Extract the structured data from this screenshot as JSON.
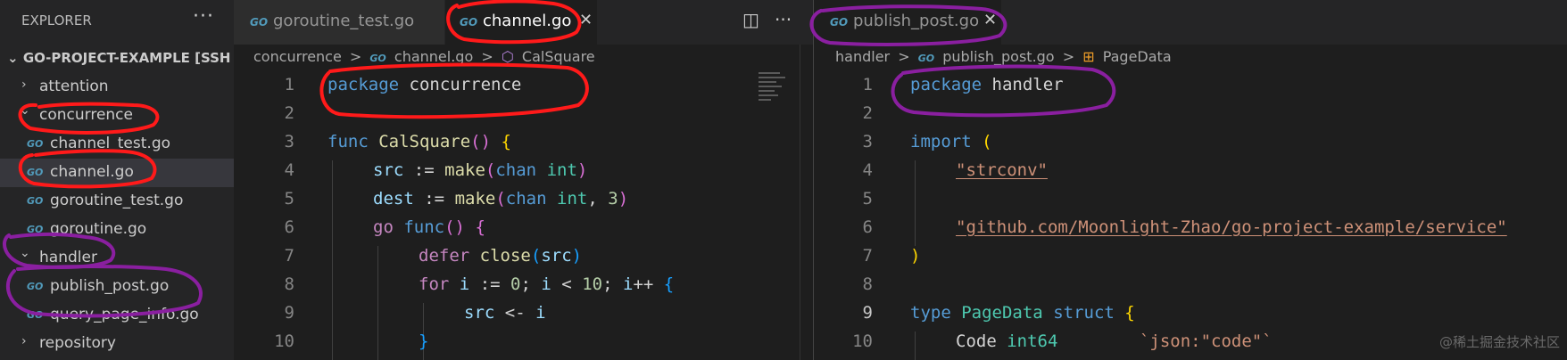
{
  "explorer": {
    "title": "EXPLORER",
    "more": "···",
    "project": "GO-PROJECT-EXAMPLE [SSH: ...",
    "items": [
      {
        "chev": "›",
        "label": "attention",
        "type": "folder"
      },
      {
        "chev": "⌄",
        "label": "concurrence",
        "type": "folder"
      },
      {
        "icon": "GO",
        "label": "channel_test.go",
        "type": "file"
      },
      {
        "icon": "GO",
        "label": "channel.go",
        "type": "file"
      },
      {
        "icon": "GO",
        "label": "goroutine_test.go",
        "type": "file"
      },
      {
        "icon": "GO",
        "label": "goroutine.go",
        "type": "file"
      },
      {
        "chev": "⌄",
        "label": "handler",
        "type": "folder"
      },
      {
        "icon": "GO",
        "label": "publish_post.go",
        "type": "file"
      },
      {
        "icon": "GO",
        "label": "query_page_info.go",
        "type": "file"
      },
      {
        "chev": "›",
        "label": "repository",
        "type": "folder"
      }
    ]
  },
  "left_editor": {
    "tabs": [
      {
        "icon": "GO",
        "label": "goroutine_test.go"
      },
      {
        "icon": "GO",
        "label": "channel.go",
        "close": "✕"
      }
    ],
    "split_icon": "◫",
    "more": "···",
    "breadcrumb": {
      "a": "concurrence",
      "sep": ">",
      "icon": "GO",
      "b": "channel.go",
      "sep2": ">",
      "c": "CalSquare"
    },
    "line_numbers": [
      "1",
      "2",
      "3",
      "4",
      "5",
      "6",
      "7",
      "8",
      "9",
      "10"
    ]
  },
  "right_editor": {
    "tabs": [
      {
        "icon": "GO",
        "label": "publish_post.go",
        "close": "✕"
      }
    ],
    "breadcrumb": {
      "a": "handler",
      "sep": ">",
      "icon": "GO",
      "b": "publish_post.go",
      "sep2": ">",
      "c": "PageData"
    },
    "line_numbers": [
      "1",
      "2",
      "3",
      "4",
      "5",
      "6",
      "7",
      "8",
      "9",
      "10"
    ]
  },
  "code_left": {
    "l1": [
      "package",
      "concurrence"
    ],
    "l3": [
      "func",
      "CalSquare",
      "()",
      "{"
    ],
    "l4": [
      "src",
      ":=",
      "make",
      "(",
      "chan",
      "int",
      ")"
    ],
    "l5": [
      "dest",
      ":=",
      "make",
      "(",
      "chan",
      "int",
      ",",
      "3",
      ")"
    ],
    "l6": [
      "go",
      "func",
      "()",
      "{"
    ],
    "l7": [
      "defer",
      "close",
      "(",
      "src",
      ")"
    ],
    "l8": [
      "for",
      "i",
      ":=",
      "0",
      ";",
      "i",
      "<",
      "10",
      ";",
      "i",
      "++",
      "{"
    ],
    "l9": [
      "src",
      "<-",
      "i"
    ],
    "l10": [
      "}"
    ]
  },
  "code_right": {
    "l1": [
      "package",
      "handler"
    ],
    "l3": [
      "import",
      "("
    ],
    "l4": [
      "\"strconv\""
    ],
    "l6": [
      "\"github.com/Moonlight-Zhao/go-project-example/service\""
    ],
    "l7": [
      ")"
    ],
    "l9": [
      "type",
      "PageData",
      "struct",
      "{"
    ],
    "l10": [
      "Code",
      "int64",
      "`json:\"code\"`"
    ]
  },
  "watermark": "@稀土掘金技术社区",
  "colors": {
    "annotation_red": "#ff1a1a",
    "annotation_purple": "#8a1fa0",
    "go_icon": "#519aba"
  }
}
